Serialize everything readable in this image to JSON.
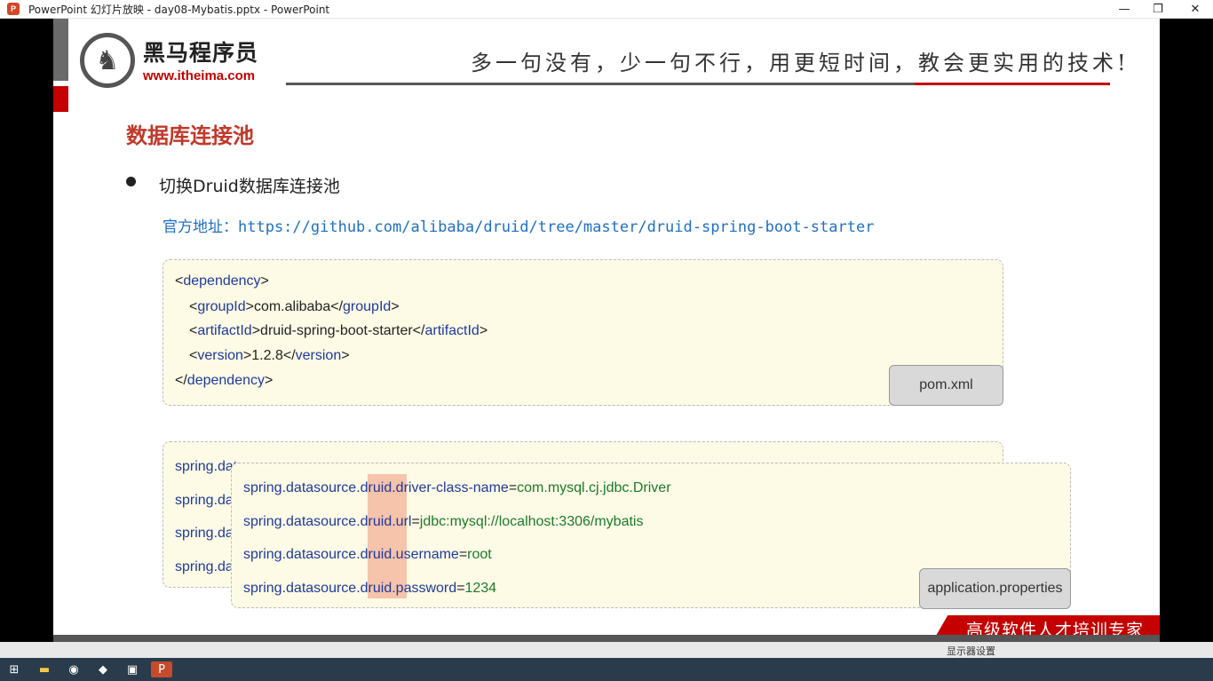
{
  "window": {
    "icon_label": "P",
    "title": "PowerPoint 幻灯片放映  -  day08-Mybatis.pptx - PowerPoint",
    "controls": {
      "minimize": "—",
      "restore": "❐",
      "close": "✕"
    }
  },
  "slide": {
    "logo": {
      "name": "黑马程序员",
      "url": "www.itheima.com",
      "icon": "horse-icon"
    },
    "slogan": "多一句没有，少一句不行，用更短时间，教会更实用的技术!",
    "title": "数据库连接池",
    "bullet": "切换Druid数据库连接池",
    "official_label": "官方地址：",
    "official_url": "https://github.com/alibaba/druid/tree/master/druid-spring-boot-starter",
    "pom": {
      "lines": [
        {
          "open": "<",
          "tag": "dependency",
          "close": ">"
        },
        {
          "open": "<",
          "tag": "groupId",
          "mid": ">com.alibaba</",
          "tag2": "groupId",
          "close": ">"
        },
        {
          "open": "<",
          "tag": "artifactId",
          "mid": ">druid-spring-boot-starter</",
          "tag2": "artifactId",
          "close": ">"
        },
        {
          "open": "<",
          "tag": "version",
          "mid": ">1.2.8</",
          "tag2": "version",
          "close": ">"
        },
        {
          "open": "</",
          "tag": "dependency",
          "close": ">"
        }
      ],
      "file_label": "pom.xml"
    },
    "props_under": {
      "lines": [
        "spring.data",
        "spring.da",
        "spring.da",
        "spring.da"
      ]
    },
    "props": {
      "lines": [
        {
          "k1": "spring.datasource.",
          "druid": "druid",
          "k2": ".driver-class-name",
          "eq": "=",
          "v": "com.mysql.cj.jdbc.Driver"
        },
        {
          "k1": "spring.datasource.",
          "druid": "druid",
          "k2": ".url",
          "eq": "=",
          "v": "jdbc:mysql://localhost:3306/mybatis"
        },
        {
          "k1": "spring.datasource.",
          "druid": "druid",
          "k2": ".username",
          "eq": "=",
          "v": "root"
        },
        {
          "k1": "spring.datasource.",
          "druid": "druid",
          "k2": ".password",
          "eq": "=",
          "v": "1234"
        }
      ],
      "file_label": "application.properties"
    },
    "banner": "高级软件人才培训专家"
  },
  "status_bar": {
    "display_settings": "显示器设置"
  },
  "taskbar": {
    "icons": [
      "windows-start-icon",
      "file-explorer-icon",
      "chrome-icon",
      "app-icon",
      "intellij-icon",
      "powerpoint-icon"
    ]
  },
  "colors": {
    "accent_red": "#c40000",
    "title_red": "#c0392b",
    "link_blue": "#1f6fc5",
    "code_bg": "#fdfbe6",
    "highlight": "#f6c3ab"
  }
}
